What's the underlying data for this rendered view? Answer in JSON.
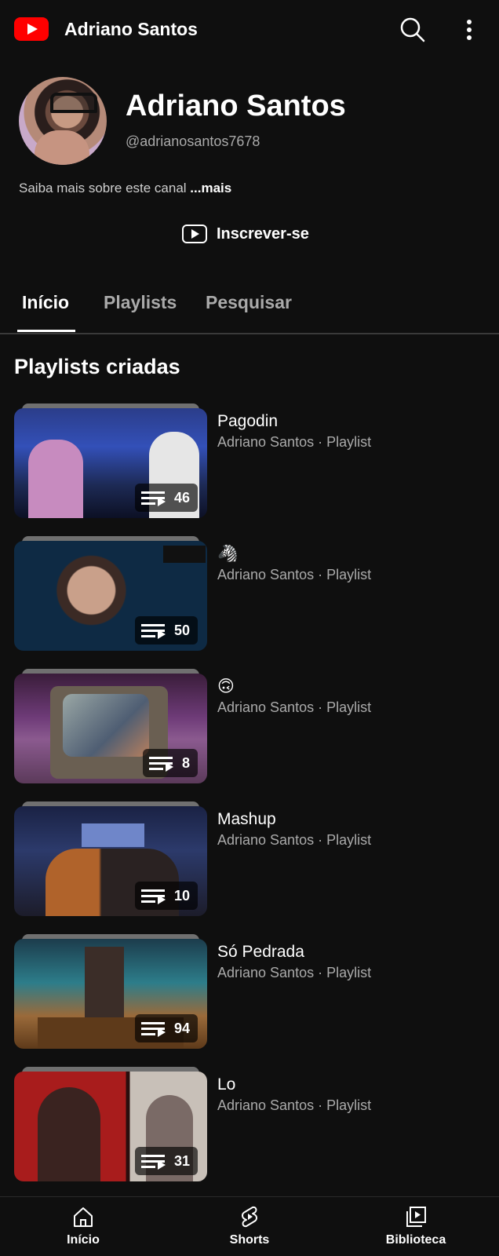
{
  "topbar": {
    "title": "Adriano Santos",
    "logo_icon": "youtube-logo-icon",
    "search_icon": "search-icon",
    "more_icon": "more-vertical-icon",
    "brand_color": "#ff0000"
  },
  "channel": {
    "name": "Adriano Santos",
    "handle": "@adrianosantos7678",
    "about": "Saiba mais sobre este canal",
    "about_more": "...mais",
    "subscribe_label": "Inscrever-se"
  },
  "tabs": [
    {
      "label": "Início",
      "active": true
    },
    {
      "label": "Playlists",
      "active": false
    },
    {
      "label": "Pesquisar",
      "active": false
    }
  ],
  "section": {
    "title": "Playlists criadas"
  },
  "playlists": [
    {
      "title": "Pagodin",
      "meta": "Adriano Santos · Playlist",
      "count": "46"
    },
    {
      "title": "🦓",
      "meta": "Adriano Santos · Playlist",
      "count": "50"
    },
    {
      "title": "🙃",
      "meta": "Adriano Santos · Playlist",
      "count": "8"
    },
    {
      "title": "Mashup",
      "meta": "Adriano Santos · Playlist",
      "count": "10"
    },
    {
      "title": "Só Pedrada",
      "meta": "Adriano Santos · Playlist",
      "count": "94"
    },
    {
      "title": "Lo",
      "meta": "Adriano Santos · Playlist",
      "count": "31"
    }
  ],
  "bottom_nav": [
    {
      "label": "Início",
      "icon": "home-icon"
    },
    {
      "label": "Shorts",
      "icon": "shorts-icon"
    },
    {
      "label": "Biblioteca",
      "icon": "library-icon"
    }
  ]
}
